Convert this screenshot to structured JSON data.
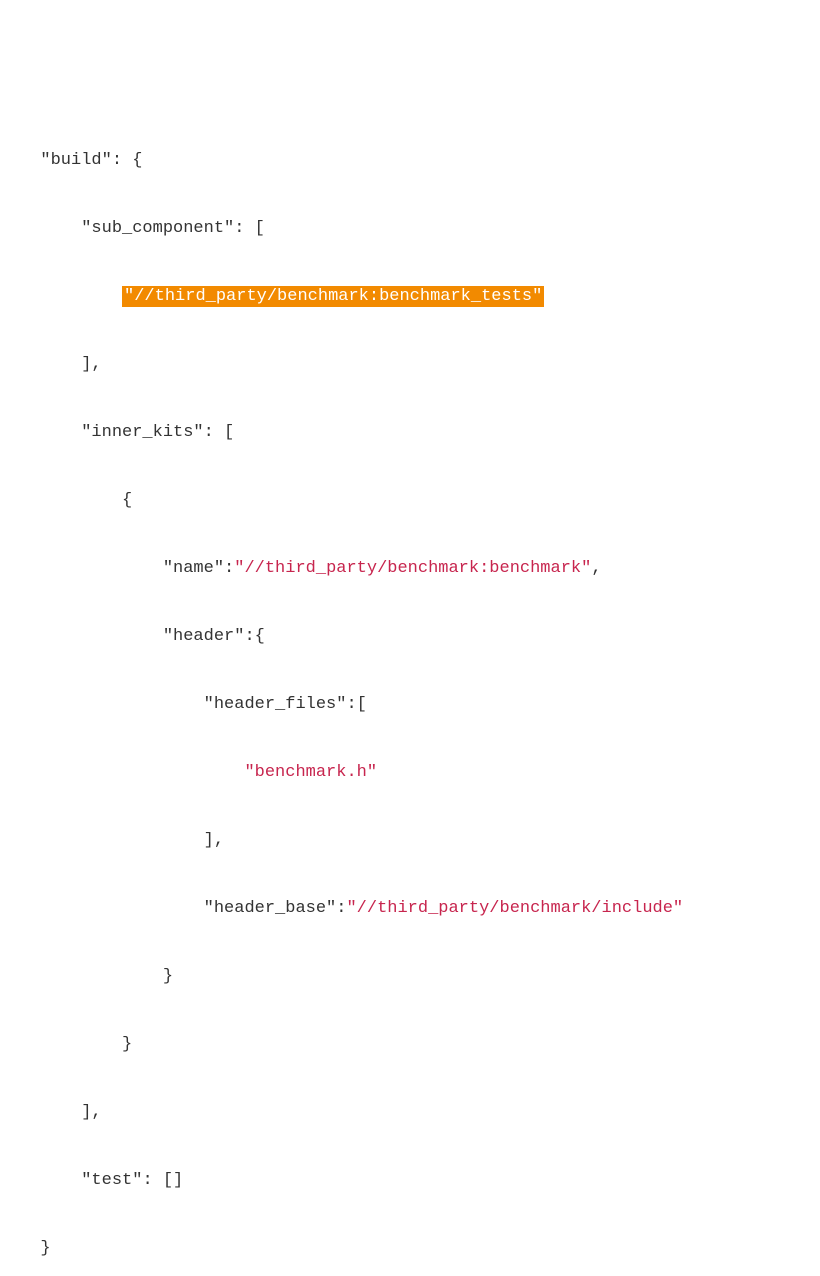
{
  "code": {
    "l1_key": "\"build\"",
    "l2_key": "\"sub_component\"",
    "l3_val": "\"//third_party/benchmark:benchmark_tests\"",
    "l5_key": "\"inner_kits\"",
    "l7_key": "\"name\"",
    "l7_val": "\"//third_party/benchmark:benchmark\"",
    "l8_key": "\"header\"",
    "l9_key": "\"header_files\"",
    "l10_val": "\"benchmark.h\"",
    "l12_key": "\"header_base\"",
    "l12_val": "\"//third_party/benchmark/include\"",
    "l16_key": "\"test\""
  }
}
